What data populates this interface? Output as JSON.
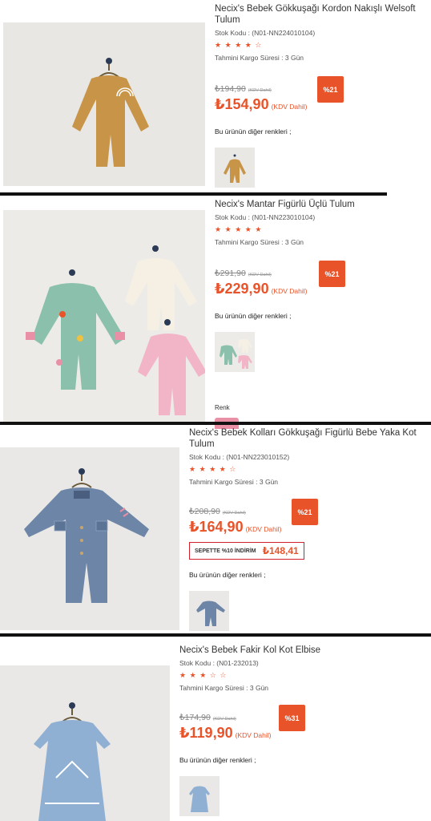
{
  "products": [
    {
      "title": "Necix's Bebek Gökkuşağı Kordon Nakışlı Welsoft Tulum",
      "sku": "Stok Kodu : (N01-NN224010104)",
      "stars": [
        "★",
        "★",
        "★",
        "★",
        "☆"
      ],
      "cargo": "Tahmini Kargo Süresi : 3 Gün",
      "old_price": "₺194,90",
      "old_kdv": "(KDV Dahil)",
      "new_price": "₺154,90",
      "new_kdv": "(KDV Dahil)",
      "discount": "%21",
      "colors_label": "Bu ürünün diğer renkleri ;"
    },
    {
      "title": "Necix's Mantar Figürlü Üçlü Tulum",
      "sku": "Stok Kodu : (N01-NN223010104)",
      "stars": [
        "★",
        "★",
        "★",
        "★",
        "★"
      ],
      "cargo": "Tahmini Kargo Süresi : 3 Gün",
      "old_price": "₺291,90",
      "old_kdv": "(KDV Dahil)",
      "new_price": "₺229,90",
      "new_kdv": "(KDV Dahil)",
      "discount": "%21",
      "colors_label": "Bu ürünün diğer renkleri ;",
      "renk_label": "Renk"
    },
    {
      "title": "Necix's Bebek Kolları Gökkuşağı Figürlü Bebe Yaka Kot Tulum",
      "sku": "Stok Kodu : (N01-NN223010152)",
      "stars": [
        "★",
        "★",
        "★",
        "★",
        "☆"
      ],
      "cargo": "Tahmini Kargo Süresi : 3 Gün",
      "old_price": "₺208,90",
      "old_kdv": "(KDV Dahil)",
      "new_price": "₺164,90",
      "new_kdv": "(KDV Dahil)",
      "discount": "%21",
      "cart_discount_label": "SEPETTE %10 İNDİRİM",
      "cart_discount_price": "₺148,41",
      "colors_label": "Bu ürünün diğer renkleri ;"
    },
    {
      "title": "Necix's Bebek Fakir Kol Kot Elbise",
      "sku": "Stok Kodu : (N01-232013)",
      "stars": [
        "★",
        "★",
        "★",
        "☆",
        "☆"
      ],
      "cargo": "Tahmini Kargo Süresi : 3 Gün",
      "old_price": "₺174,90",
      "old_kdv": "(KDV Dahil)",
      "new_price": "₺119,90",
      "new_kdv": "(KDV Dahil)",
      "discount": "%31",
      "colors_label": "Bu ürünün diğer renkleri ;"
    }
  ],
  "colors": {
    "accent": "#e9532a",
    "cart_border": "#d3202c",
    "divider": "#111111"
  }
}
